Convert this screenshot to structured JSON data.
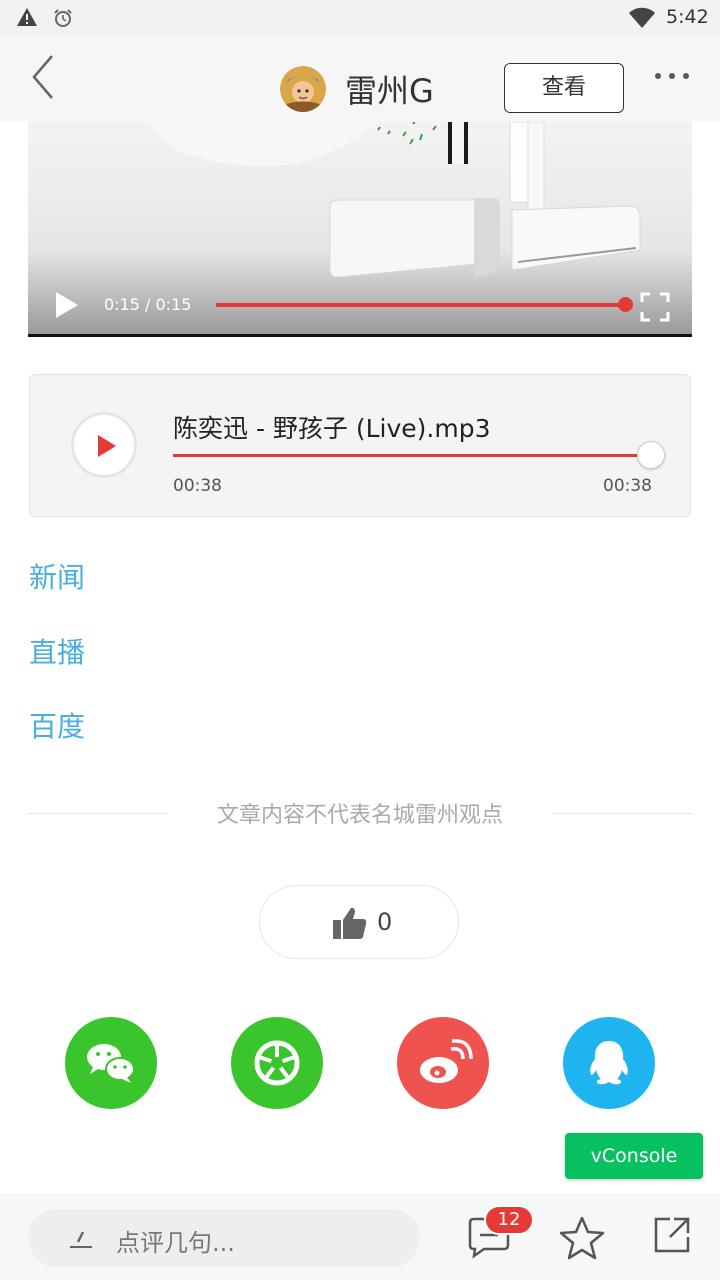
{
  "status_bar": {
    "time": "5:42"
  },
  "header": {
    "title": "雷州G",
    "view_button": "查看"
  },
  "video": {
    "time_display": "0:15 / 0:15",
    "progress": 1.0
  },
  "audio": {
    "title": "陈奕迅 - 野孩子 (Live).mp3",
    "current": "00:38",
    "total": "00:38",
    "progress": 1.0
  },
  "links": [
    "新闻",
    "直播",
    "百度"
  ],
  "disclaimer": "文章内容不代表名城雷州观点",
  "like": {
    "count": "0"
  },
  "share": [
    {
      "icon": "wechat-icon",
      "color": "#3ac52c"
    },
    {
      "icon": "moments-icon",
      "color": "#3ac52c"
    },
    {
      "icon": "weibo-icon",
      "color": "#ef5350"
    },
    {
      "icon": "qq-icon",
      "color": "#1eb4f0"
    }
  ],
  "vconsole": "vConsole",
  "bottom_bar": {
    "placeholder": "点评几句...",
    "comment_count": "12"
  }
}
